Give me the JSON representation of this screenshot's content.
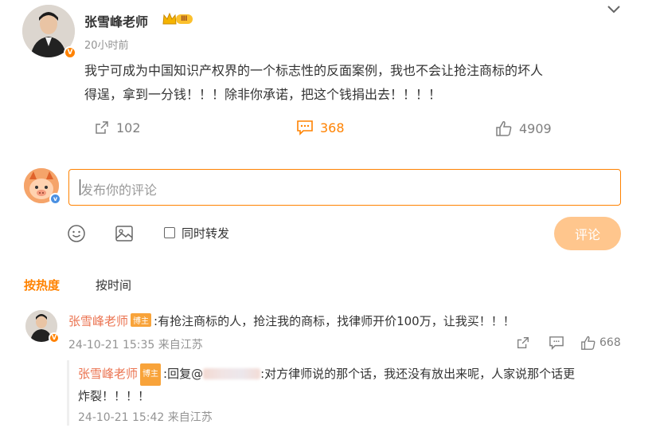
{
  "post": {
    "author": "张雪峰老师",
    "time": "20小时前",
    "text_line1": "我宁可成为中国知识产权界的一个标志性的反面案例，我也不会让抢注商标的坏人",
    "text_line2": "得逞，拿到一分钱！！！除非你承诺，把这个钱捐出去！！！！",
    "reposts": "102",
    "comments": "368",
    "likes": "4909",
    "level_badge": "Ⅲ"
  },
  "composer": {
    "placeholder": "发布你的评论",
    "repost_label": "同时转发",
    "submit_label": "评论"
  },
  "tabs": {
    "hot": "按热度",
    "time": "按时间"
  },
  "comments": [
    {
      "author": "张雪峰老师",
      "badge": "博主",
      "text": ":有抢注商标的人，抢注我的商标，找律师开价100万，让我买！！！",
      "meta": "24-10-21 15:35 来自江苏",
      "likes": "668",
      "reply": {
        "author": "张雪峰老师",
        "badge": "博主",
        "prefix": ":回复@",
        "text": ":对方律师说的那个话，我还没有放出来呢，人家说那个话更",
        "text_line2": "炸裂！！！！",
        "meta": "24-10-21 15:42 来自江苏"
      }
    }
  ],
  "colors": {
    "accent": "#ff8200",
    "name": "#eb7350",
    "submit_disabled": "#ffc68d"
  }
}
